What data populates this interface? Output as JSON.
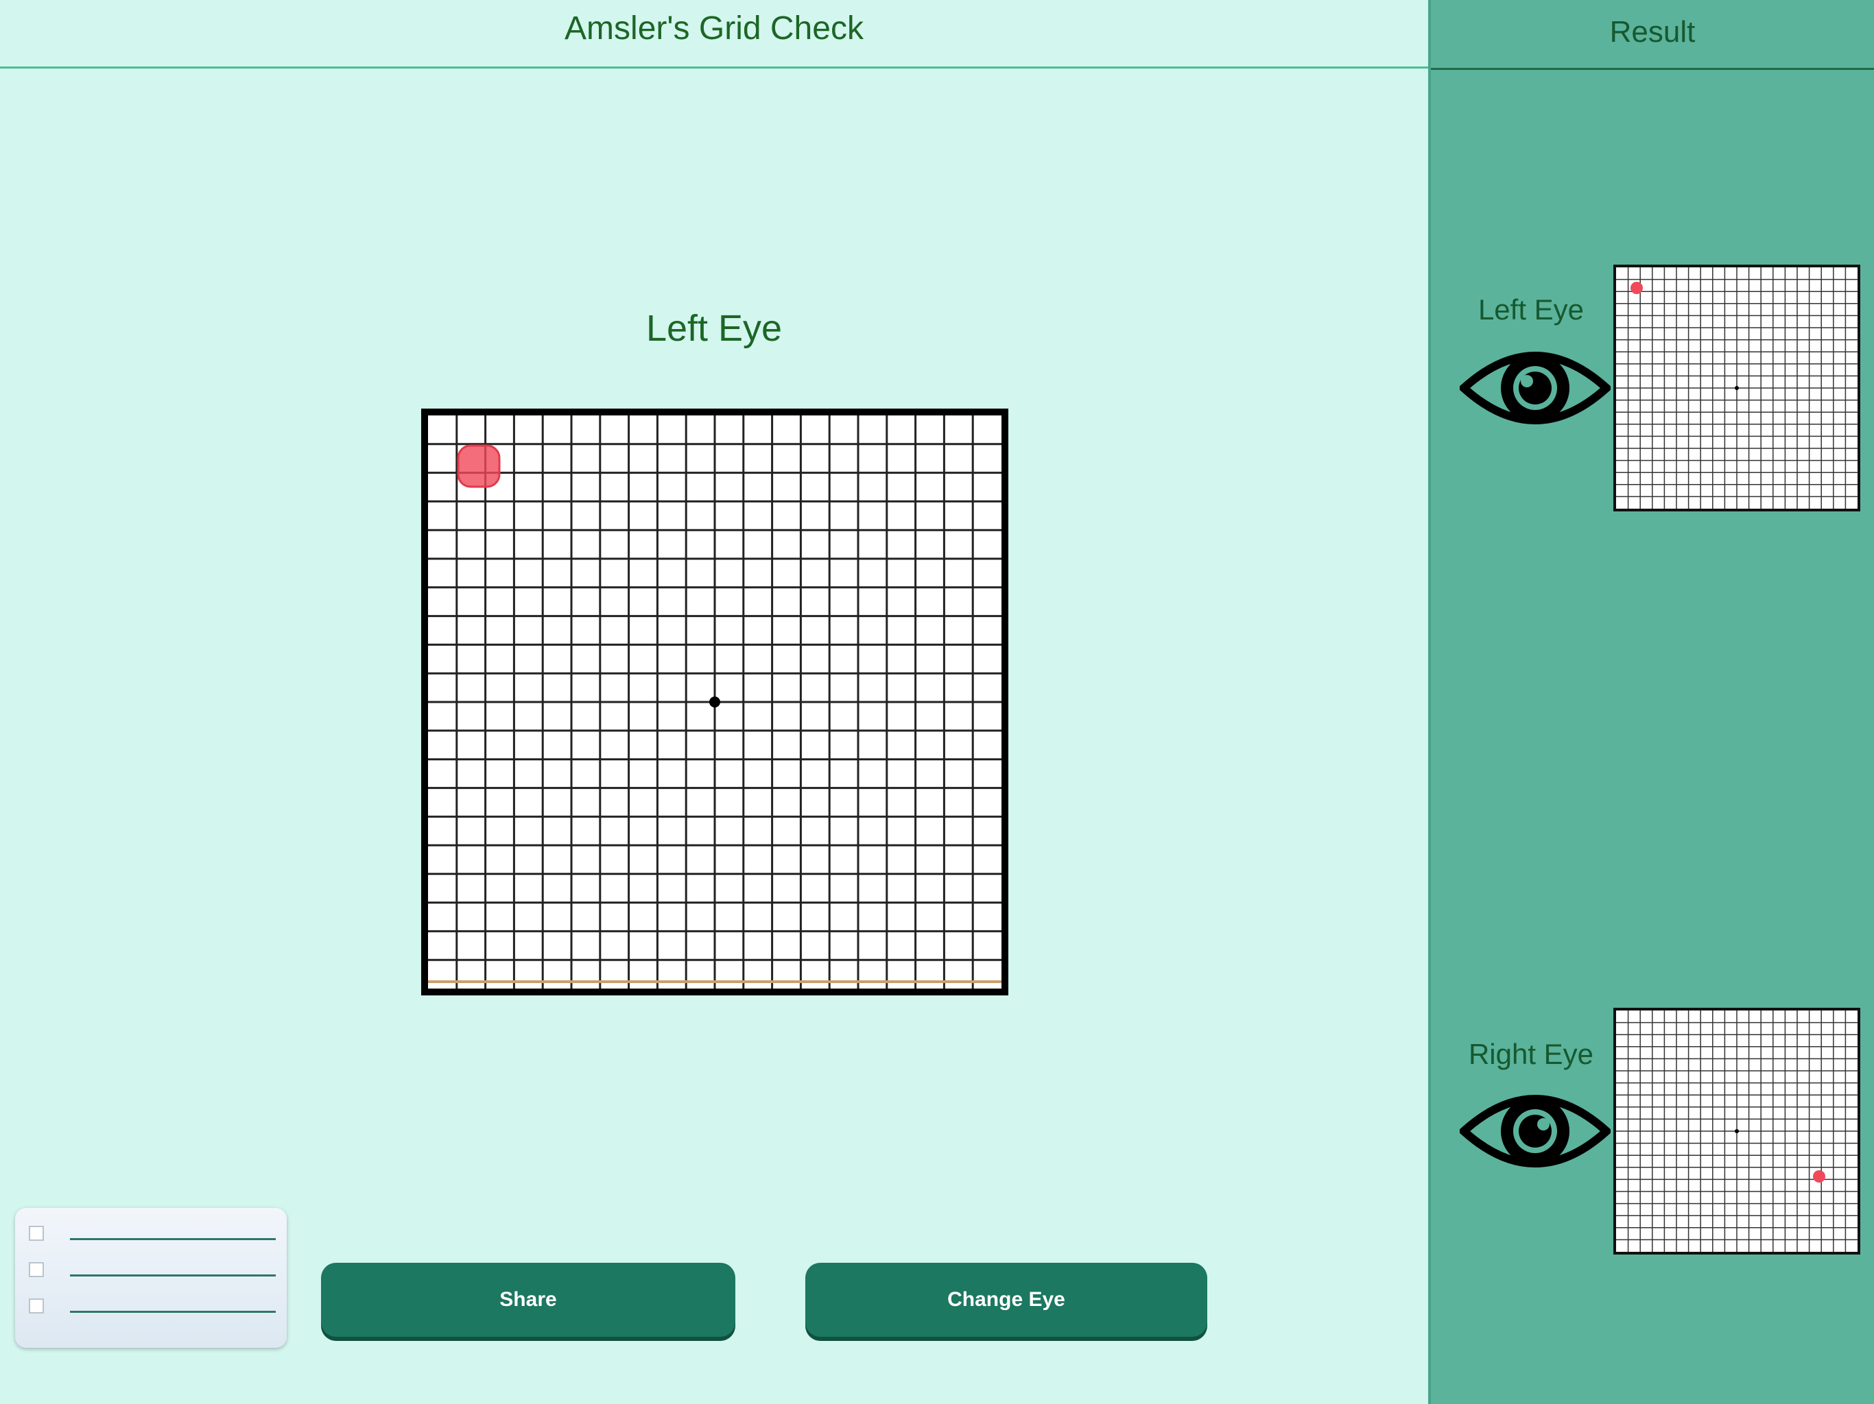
{
  "header": {
    "title": "Amsler's Grid Check"
  },
  "side_panel": {
    "title": "Result",
    "left": {
      "label": "Left Eye",
      "icon": "eye-icon"
    },
    "right": {
      "label": "Right Eye",
      "icon": "eye-icon"
    }
  },
  "main": {
    "eye_title": "Left Eye"
  },
  "buttons": {
    "share_label": "Share",
    "change_eye_label": "Change Eye"
  },
  "checklist": {
    "icon": "checklist-icon",
    "rows": 3
  },
  "colors": {
    "background": "#d3f6ee",
    "panel": "#5bb39c",
    "accent_button": "#1c7860",
    "title_text": "#1c6626",
    "marker": "#f0495a"
  }
}
